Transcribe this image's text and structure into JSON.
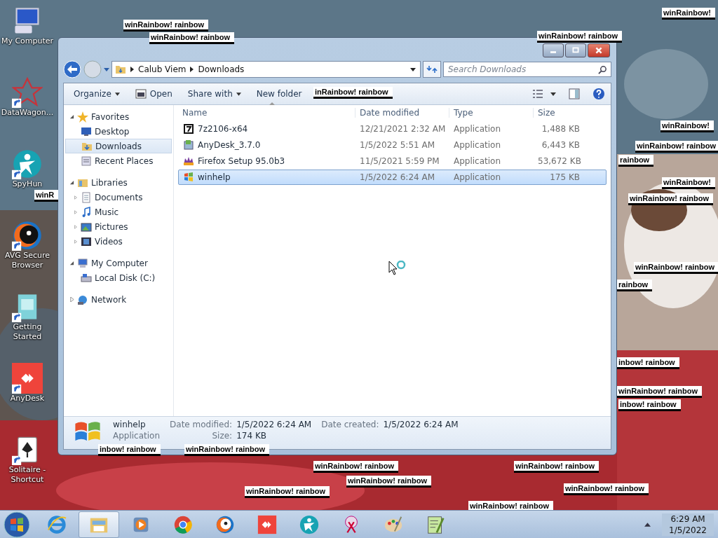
{
  "desktop_icons": [
    {
      "kind": "computer",
      "label": "My Computer",
      "shortcut": false
    },
    {
      "kind": "datawagon",
      "label": "DataWagon...",
      "shortcut": true
    },
    {
      "kind": "spyhunter",
      "label": "SpyHun",
      "shortcut": true
    },
    {
      "kind": "avg",
      "label": "AVG Secure Browser",
      "shortcut": true
    },
    {
      "kind": "getting-started",
      "label": "Getting Started",
      "shortcut": true
    },
    {
      "kind": "anydesk",
      "label": "AnyDesk",
      "shortcut": true
    },
    {
      "kind": "solitaire",
      "label": "Solitaire - Shortcut",
      "shortcut": true
    }
  ],
  "window": {
    "breadcrumb": [
      "Calub Viem",
      "Downloads"
    ],
    "search": {
      "placeholder": "Search Downloads"
    },
    "toolbar": [
      {
        "label": "Organize",
        "dropdown": true,
        "kind": "text"
      },
      {
        "label": "Open",
        "dropdown": false,
        "kind": "open"
      },
      {
        "label": "Share with",
        "dropdown": true,
        "kind": "text"
      },
      {
        "label": "New folder",
        "dropdown": false,
        "kind": "text"
      }
    ],
    "sidebar": [
      {
        "label": "Favorites",
        "kind": "star",
        "expanded": true,
        "children": [
          {
            "label": "Desktop",
            "kind": "desktop",
            "selected": false
          },
          {
            "label": "Downloads",
            "kind": "downloads",
            "selected": true
          },
          {
            "label": "Recent Places",
            "kind": "recent",
            "selected": false
          }
        ]
      },
      {
        "label": "Libraries",
        "kind": "libraries",
        "expanded": true,
        "children": [
          {
            "label": "Documents",
            "kind": "documents",
            "selected": false,
            "expanded": false
          },
          {
            "label": "Music",
            "kind": "music",
            "selected": false,
            "expanded": false
          },
          {
            "label": "Pictures",
            "kind": "pictures",
            "selected": false,
            "expanded": false
          },
          {
            "label": "Videos",
            "kind": "videos",
            "selected": false,
            "expanded": false
          }
        ]
      },
      {
        "label": "My Computer",
        "kind": "computer",
        "expanded": true,
        "children": [
          {
            "label": "Local Disk (C:)",
            "kind": "disk",
            "selected": false
          }
        ]
      },
      {
        "label": "Network",
        "kind": "network",
        "expanded": false
      }
    ],
    "columns": [
      "Name",
      "Date modified",
      "Type",
      "Size"
    ],
    "files": [
      {
        "kind": "archive",
        "name": "7z2106-x64",
        "date": "12/21/2021 2:32 AM",
        "type": "Application",
        "size": "1,488 KB",
        "selected": false
      },
      {
        "kind": "installer",
        "name": "AnyDesk_3.7.0",
        "date": "1/5/2022 5:51 AM",
        "type": "Application",
        "size": "6,443 KB",
        "selected": false
      },
      {
        "kind": "firefox",
        "name": "Firefox Setup 95.0b3",
        "date": "11/5/2021 5:59 PM",
        "type": "Application",
        "size": "53,672 KB",
        "selected": false
      },
      {
        "kind": "windows",
        "name": "winhelp",
        "date": "1/5/2022 6:24 AM",
        "type": "Application",
        "size": "175 KB",
        "selected": true
      }
    ],
    "details": {
      "name": "winhelp",
      "type": "Application",
      "modified_label": "Date modified:",
      "modified": "1/5/2022 6:24 AM",
      "created_label": "Date created:",
      "created": "1/5/2022 6:24 AM",
      "size_label": "Size:",
      "size": "174 KB"
    }
  },
  "overlay_labels": [
    "winRainbow! rainbow",
    "winRainbow! rainbow",
    "winRainbow! rainbow",
    "winRainbow!",
    "inRainbow! rainbow",
    "winR",
    "winRainbow!",
    "winRainbow! rainbow",
    "rainbow",
    "winRainbow!",
    "winRainbow! rainbow",
    "winRainbow! rainbow",
    "rainbow",
    "inbow! rainbow",
    "winRainbow! rainbow",
    "inbow! rainbow",
    "inbow! rainbow",
    "winRainbow! rainbow",
    "winRainbow! rainbow",
    "winRainbow! rainbow",
    "winRainbow! rainbow",
    "winRainbow! rainbow",
    "winRainbow! rainbow",
    "winRainbow! rainbow"
  ],
  "taskbar": {
    "items": [
      {
        "kind": "ie",
        "active": false
      },
      {
        "kind": "explorer",
        "active": true
      },
      {
        "kind": "media",
        "active": false
      },
      {
        "kind": "chrome",
        "active": false
      },
      {
        "kind": "avg",
        "active": false
      },
      {
        "kind": "anydesk",
        "active": false
      },
      {
        "kind": "spyhunter",
        "active": false
      },
      {
        "kind": "snipping",
        "active": false
      },
      {
        "kind": "paint",
        "active": false
      },
      {
        "kind": "notepad",
        "active": false
      }
    ],
    "time": "6:29 AM",
    "date": "1/5/2022"
  }
}
